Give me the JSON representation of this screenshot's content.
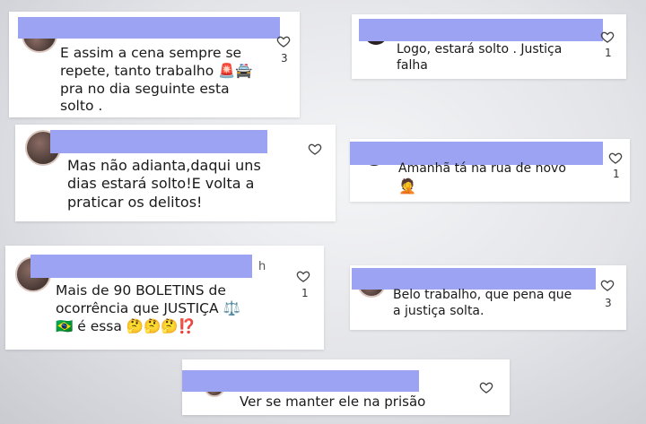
{
  "comments": [
    {
      "text": "E assim a cena sempre se\nrepete, tanto trabalho 🚨🚔\npra no dia seguinte esta\nsolto .",
      "likes": "3"
    },
    {
      "text": "Logo, estará solto .  Justiça\nfalha",
      "likes": "1"
    },
    {
      "text": "Mas não adianta,daqui uns\ndias estará solto!E volta a\npraticar os delitos!",
      "likes": ""
    },
    {
      "text": "Amanhã tá na rua de novo",
      "emoji": "🤦",
      "likes": "1"
    },
    {
      "text": "Mais de 90 BOLETINS de\nocorrência que JUSTIÇA ⚖️\n🇧🇷 é essa 🤔🤔🤔⁉️",
      "likes": "1",
      "time": "h"
    },
    {
      "text": "Belo trabalho, que pena que\na justiça solta.",
      "likes": "3"
    },
    {
      "text": "Ver se manter ele na prisão",
      "likes": ""
    }
  ],
  "icons": {
    "like": "heart-outline-icon"
  },
  "colors": {
    "redaction": "#9ba3f2",
    "card": "#ffffff"
  }
}
